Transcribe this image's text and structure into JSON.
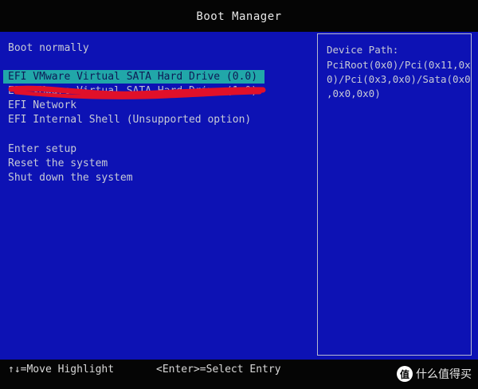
{
  "title": "Boot Manager",
  "menu": {
    "boot_normally": "Boot normally",
    "efi_vmware_hd": "EFI VMware Virtual SATA Hard Drive (0.0)",
    "efi_vmware_hd_2": "EFI VMware Virtual SATA Hard Drive (1.0)",
    "efi_network": "EFI Network",
    "efi_shell": "EFI Internal Shell (Unsupported option)",
    "enter_setup": "Enter setup",
    "reset_system": "Reset the system",
    "shutdown_system": "Shut down the system"
  },
  "info": {
    "label": "Device Path:",
    "lines": [
      "PciRoot(0x0)/Pci(0x11,0x",
      "0)/Pci(0x3,0x0)/Sata(0x0",
      ",0x0,0x0)"
    ]
  },
  "footer": {
    "move_hint": "↑↓=Move Highlight",
    "enter_hint": "<Enter>=Select Entry"
  },
  "watermark": {
    "logo": "值",
    "text": "什么值得买"
  },
  "colors": {
    "background": "#0d12b4",
    "highlight": "#21a7a9",
    "annotation": "#e0102a"
  }
}
